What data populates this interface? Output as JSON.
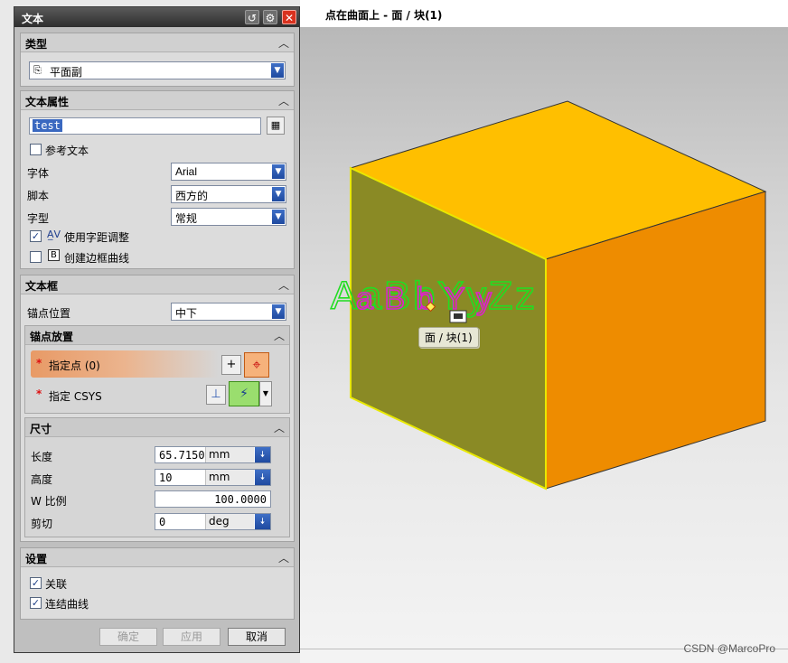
{
  "status_bar": {
    "text": "点在曲面上 - 面 / 块(1)"
  },
  "dialog": {
    "title": "文本",
    "title_buttons": [
      "reset-icon",
      "settings-icon",
      "close-icon"
    ],
    "sections": {
      "type": {
        "title": "类型",
        "selected": "平面副"
      },
      "text_props": {
        "title": "文本属性",
        "text_value": "test",
        "reference_text_label": "参考文本",
        "reference_text_checked": false,
        "font_label": "字体",
        "font_value": "Arial",
        "script_label": "脚本",
        "script_value": "西方的",
        "style_label": "字型",
        "style_value": "常规",
        "kerning_label": "使用字距调整",
        "kerning_checked": true,
        "border_label": "创建边框曲线",
        "border_checked": false
      },
      "text_frame": {
        "title": "文本框",
        "anchor_pos_label": "锚点位置",
        "anchor_pos_value": "中下",
        "anchor_place": {
          "title": "锚点放置",
          "specify_point_label": "指定点 (0)",
          "specify_csys_label": "指定 CSYS",
          "star": "*"
        },
        "dimensions": {
          "title": "尺寸",
          "length_label": "长度",
          "length_value": "65.71501",
          "length_unit": "mm",
          "height_label": "高度",
          "height_value": "10",
          "height_unit": "mm",
          "wscale_label": "W 比例",
          "wscale_value": "100.0000",
          "shear_label": "剪切",
          "shear_value": "0",
          "shear_unit": "deg"
        }
      },
      "settings": {
        "title": "设置",
        "associative_label": "关联",
        "associative_checked": true,
        "join_label": "连结曲线",
        "join_checked": true
      }
    },
    "buttons": {
      "ok": "确定",
      "apply": "应用",
      "cancel": "取消"
    }
  },
  "viewport": {
    "preview_text": "AaBbYyZz",
    "tooltip": "面 / 块(1)",
    "colors": {
      "box_top": "#ffbf00",
      "box_right": "#ee8c00",
      "box_left": "#8a8a25",
      "edge_highlight": "#e8e800",
      "text_green": "#22dd22",
      "text_magenta": "#dd22cc"
    }
  },
  "watermark": "CSDN @MarcoPro"
}
